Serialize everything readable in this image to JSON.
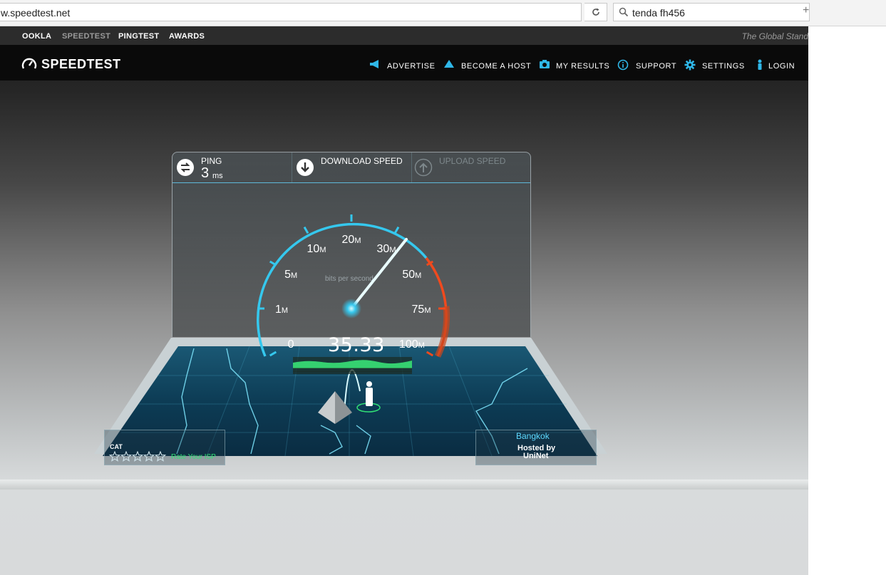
{
  "browser": {
    "url": "w.speedtest.net",
    "search_query": "tenda fh456",
    "plus": "+"
  },
  "topnav": {
    "items": [
      "OOKLA",
      "SPEEDTEST",
      "PINGTEST",
      "AWARDS"
    ],
    "tagline": "The Global Stand"
  },
  "header": {
    "logo": "SPEEDTEST",
    "nav": [
      "ADVERTISE",
      "BECOME A HOST",
      "MY RESULTS",
      "SUPPORT",
      "SETTINGS",
      "LOGIN"
    ]
  },
  "meter": {
    "ping_label": "PING",
    "ping_value": "3",
    "ping_unit": "ms",
    "download_label": "DOWNLOAD SPEED",
    "upload_label": "UPLOAD SPEED",
    "unit_caption": "bits per second",
    "scale_labels": [
      {
        "num": "0",
        "unit": ""
      },
      {
        "num": "1",
        "unit": "M"
      },
      {
        "num": "5",
        "unit": "M"
      },
      {
        "num": "10",
        "unit": "M"
      },
      {
        "num": "20",
        "unit": "M"
      },
      {
        "num": "30",
        "unit": "M"
      },
      {
        "num": "50",
        "unit": "M"
      },
      {
        "num": "75",
        "unit": "M"
      },
      {
        "num": "100",
        "unit": "M"
      }
    ],
    "current_speed": "35.33",
    "needle_fraction": 0.66,
    "accent_color": "#35c8ee",
    "danger_color": "#f04a1e"
  },
  "isp": {
    "name": "CAT",
    "rate_label": "Rate Your ISP",
    "stars": 5
  },
  "server": {
    "city": "Bangkok",
    "hosted_by": "Hosted by",
    "name": "UniNet"
  }
}
